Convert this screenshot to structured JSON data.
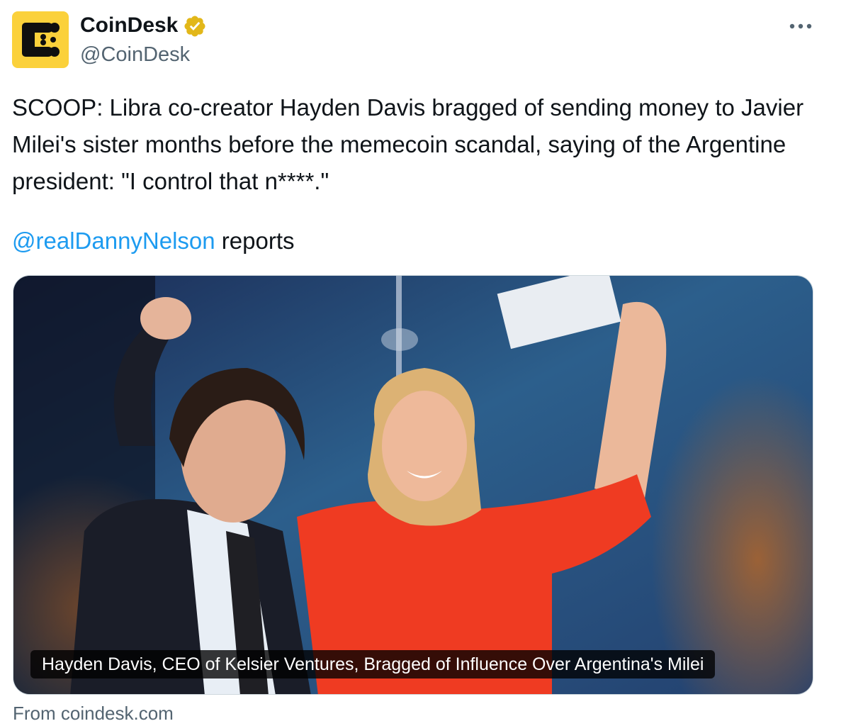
{
  "author": {
    "name": "CoinDesk",
    "handle": "@CoinDesk",
    "avatar_icon": "coindesk-logo",
    "avatar_color": "#fbd13b",
    "verified": true,
    "verified_badge_color": "#e2b719"
  },
  "more_icon": "more-horizontal-icon",
  "tweet": {
    "text": "SCOOP: Libra co-creator Hayden Davis bragged of sending money to Javier Milei's sister months before the memecoin scandal, saying of the Argentine president: \"I control that n****.\"",
    "mention": "@realDannyNelson",
    "mention_suffix": " reports"
  },
  "card": {
    "caption": "Hayden Davis, CEO of Kelsier Ventures, Bragged of Influence Over Argentina's Milei",
    "source": "From coindesk.com"
  },
  "colors": {
    "text": "#0f1419",
    "secondary_text": "#536471",
    "link": "#1d9bf0",
    "border": "#cfd9de"
  }
}
